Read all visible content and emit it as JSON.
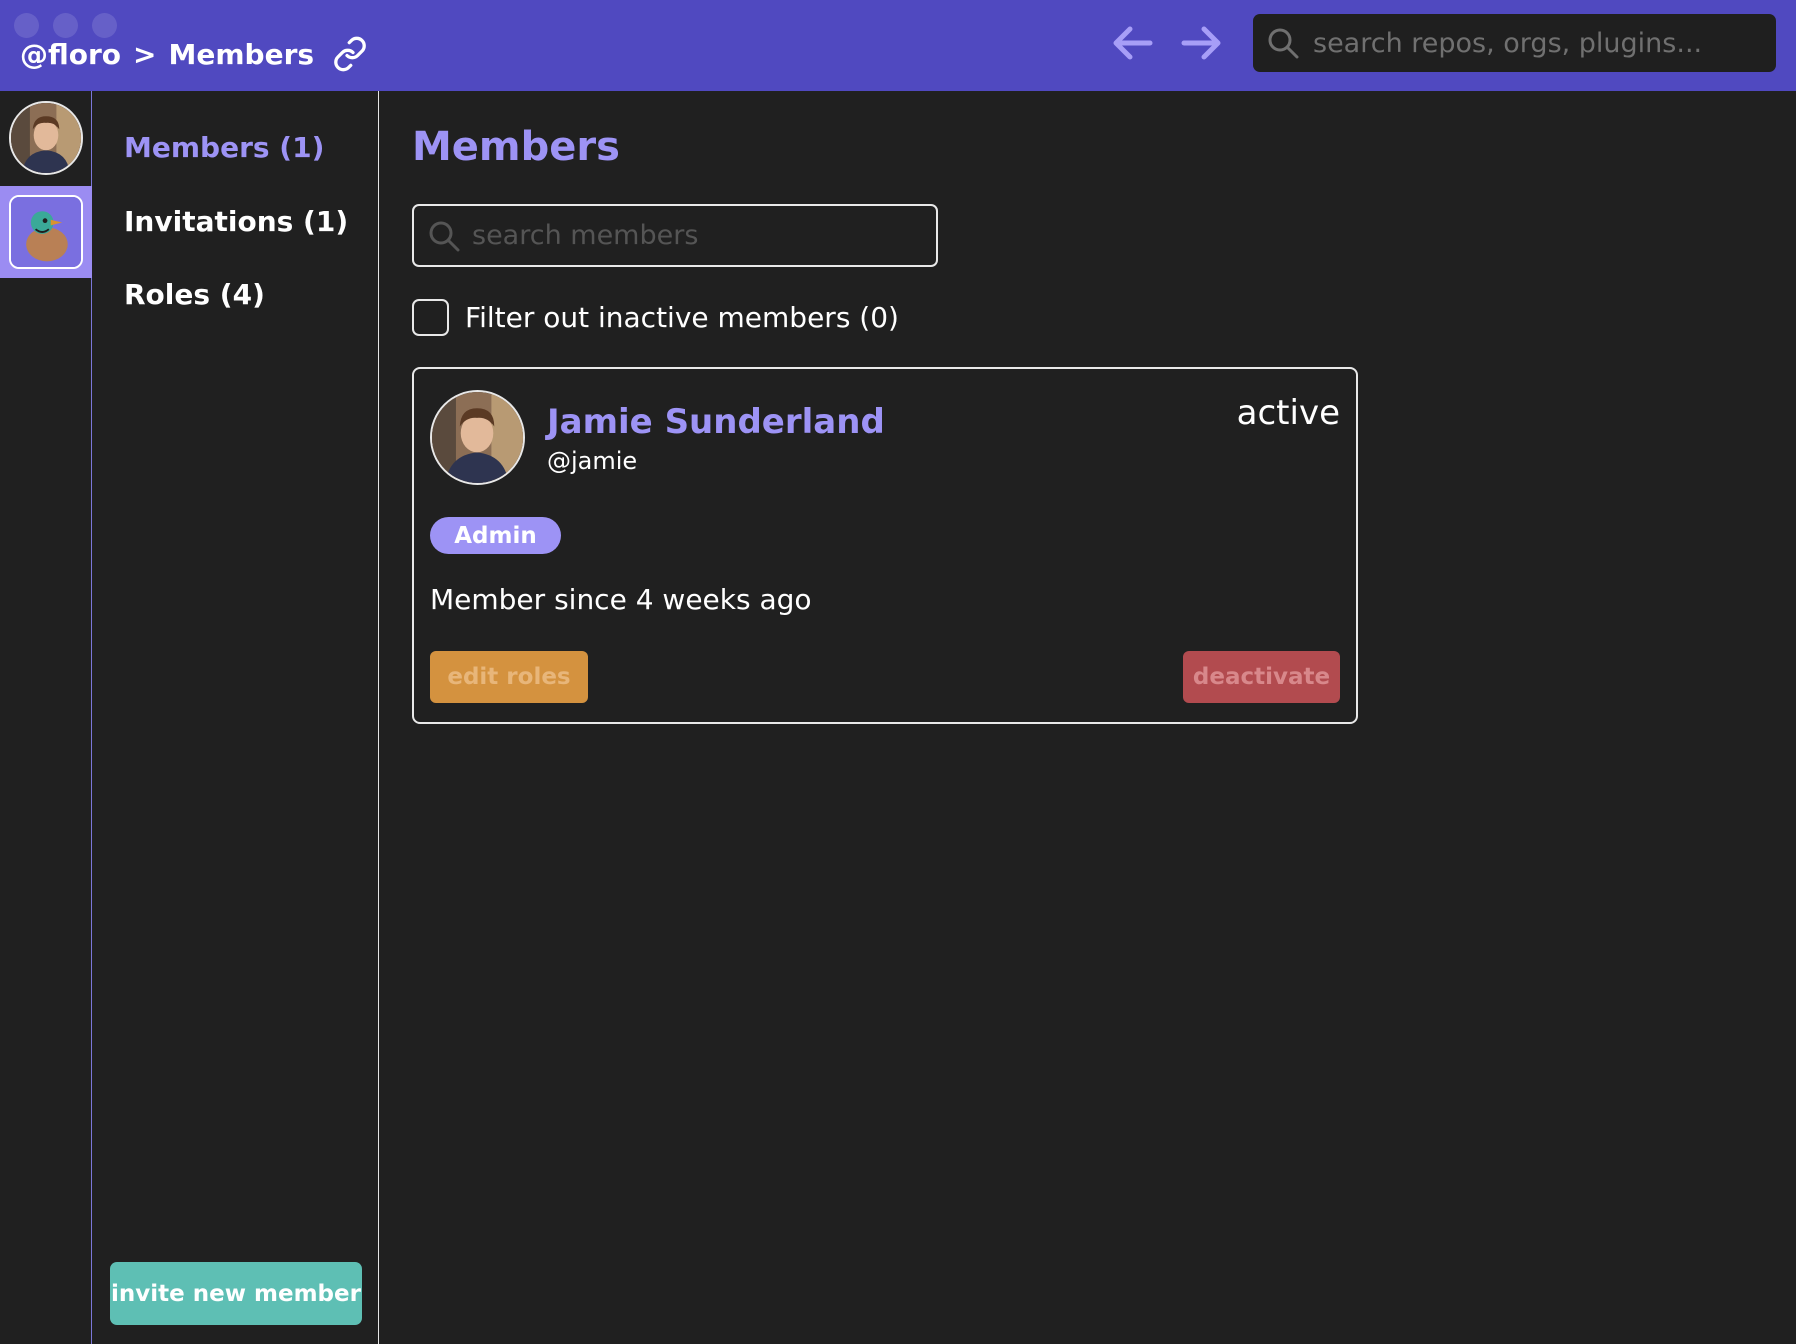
{
  "titlebar": {
    "org_handle": "@floro",
    "separator": ">",
    "page": "Members",
    "search_placeholder": "search repos, orgs, plugins...",
    "icons": [
      "link-icon",
      "arrow-left-icon",
      "arrow-right-icon",
      "search-icon"
    ]
  },
  "sidenav": {
    "items": [
      {
        "label": "Members (1)",
        "active": true
      },
      {
        "label": "Invitations (1)",
        "active": false
      },
      {
        "label": "Roles (4)",
        "active": false
      }
    ],
    "invite_label": "invite new member"
  },
  "main": {
    "title": "Members",
    "search_placeholder": "search members",
    "filter_label": "Filter out inactive members (0)",
    "filter_checked": false
  },
  "member": {
    "name": "Jamie Sunderland",
    "handle": "@jamie",
    "status": "active",
    "role": "Admin",
    "since": "Member since 4 weeks ago",
    "edit_roles_label": "edit roles",
    "deactivate_label": "deactivate"
  },
  "colors": {
    "titlebar": "#5049c0",
    "background": "#202020",
    "accent": "#9d93f5",
    "invite": "#5ebfb4",
    "edit": "#d4923f",
    "deactivate": "#b24b4f"
  }
}
